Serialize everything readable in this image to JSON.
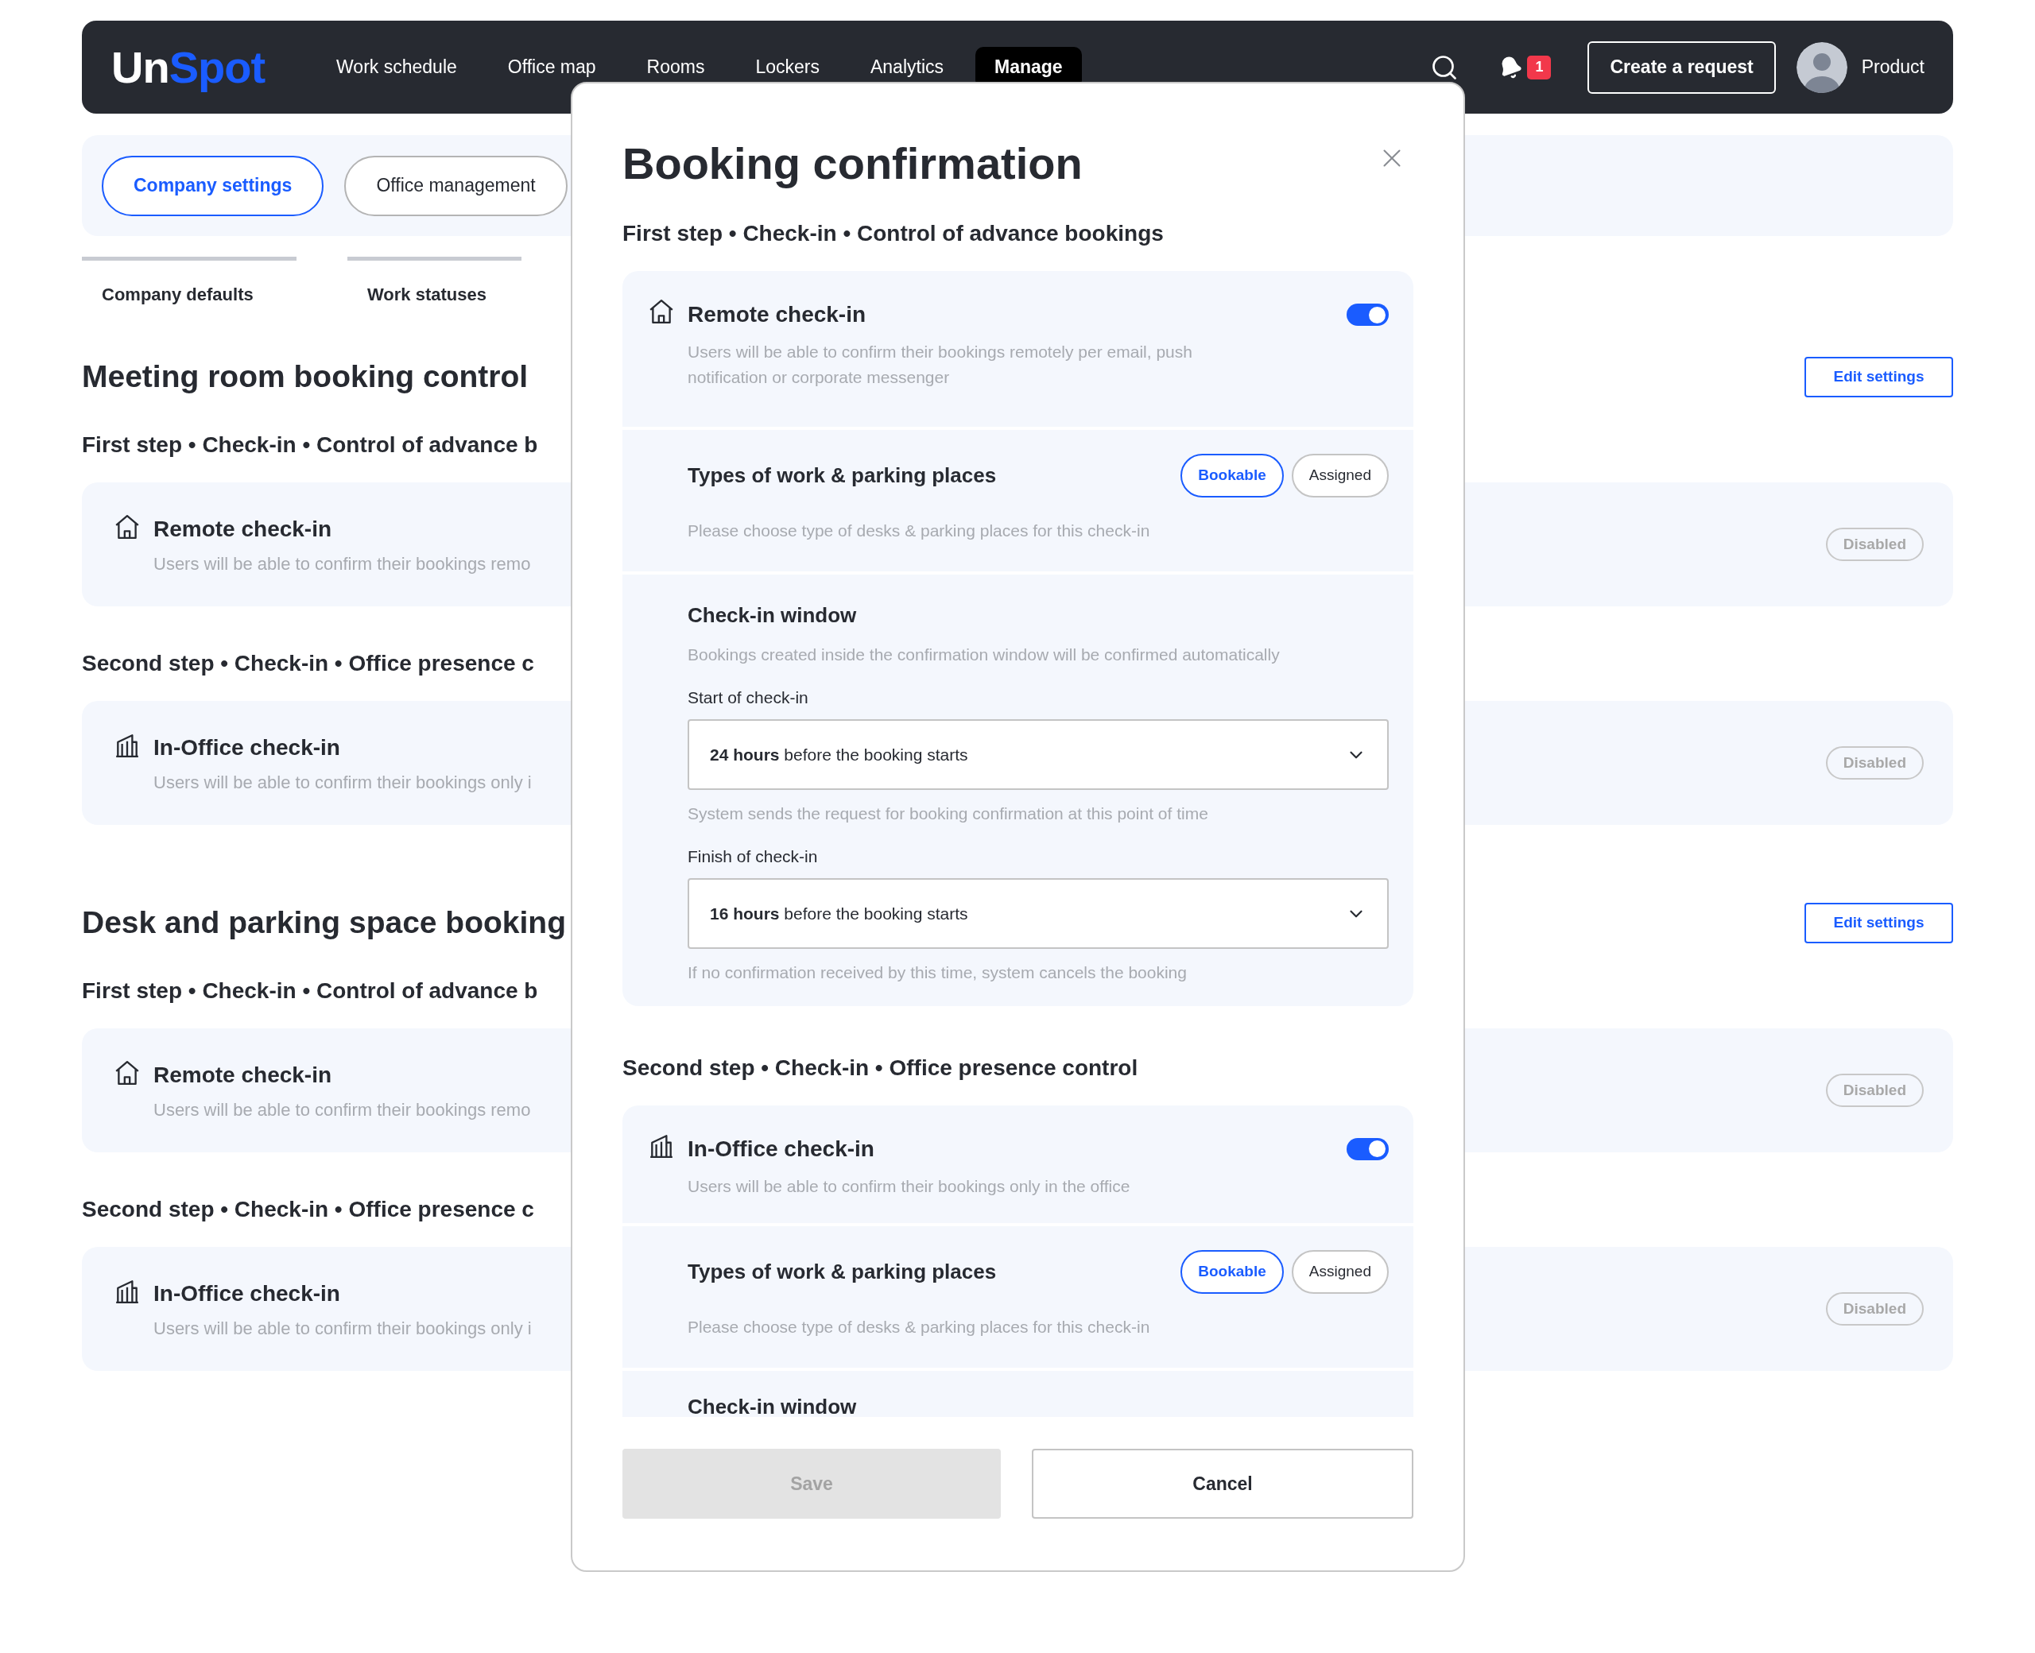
{
  "header": {
    "logo": {
      "first": "Un",
      "second": "Spot"
    },
    "nav": [
      {
        "label": "Work schedule",
        "selected": false
      },
      {
        "label": "Office map",
        "selected": false
      },
      {
        "label": "Rooms",
        "selected": false
      },
      {
        "label": "Lockers",
        "selected": false
      },
      {
        "label": "Analytics",
        "selected": false
      },
      {
        "label": "Manage",
        "selected": true
      }
    ],
    "notifications_badge": "1",
    "create_button": "Create a request",
    "user_name": "Product"
  },
  "section_tabs": [
    {
      "label": "Company settings",
      "selected": true
    },
    {
      "label": "Office management",
      "selected": false
    }
  ],
  "sub_tabs": [
    {
      "label": "Company defaults"
    },
    {
      "label": "Work statuses"
    }
  ],
  "sections": [
    {
      "title": "Meeting room booking control",
      "edit_button": "Edit settings",
      "steps": [
        {
          "heading": "First step • Check-in • Control of advance b",
          "card": {
            "kind": "remote",
            "title": "Remote check-in",
            "description": "Users will be able to confirm their bookings remo",
            "status": "Disabled"
          }
        },
        {
          "heading": "Second step • Check-in • Office presence c",
          "card": {
            "kind": "office",
            "title": "In-Office check-in",
            "description": "Users will be able to confirm their bookings only i",
            "status": "Disabled"
          }
        }
      ]
    },
    {
      "title": "Desk and parking space booking",
      "edit_button": "Edit settings",
      "steps": [
        {
          "heading": "First step • Check-in • Control of advance b",
          "card": {
            "kind": "remote",
            "title": "Remote check-in",
            "description": "Users will be able to confirm their bookings remo",
            "status": "Disabled"
          }
        },
        {
          "heading": "Second step • Check-in • Office presence c",
          "card": {
            "kind": "office",
            "title": "In-Office check-in",
            "description": "Users will be able to confirm their bookings only i",
            "status": "Disabled"
          }
        }
      ]
    }
  ],
  "dialog": {
    "title": "Booking confirmation",
    "steps": [
      {
        "heading": "First step • Check-in • Control of advance bookings",
        "setting": {
          "kind": "remote",
          "title": "Remote check-in",
          "description": "Users will be able to confirm their bookings remotely per email, push notification or corporate messenger",
          "on": true
        },
        "types": {
          "title": "Types of work & parking places",
          "description": "Please choose type of desks & parking places for this check-in",
          "options": [
            {
              "label": "Bookable",
              "selected": true
            },
            {
              "label": "Assigned",
              "selected": false
            }
          ]
        },
        "window": {
          "title": "Check-in window",
          "description": "Bookings created inside the confirmation window will be confirmed automatically",
          "fields": [
            {
              "label": "Start of check-in",
              "value": "**24 hours** before the booking starts",
              "help": "System sends the request for booking confirmation at this point of time"
            },
            {
              "label": "Finish of check-in",
              "value": "**16 hours** before the booking starts",
              "help": "If no confirmation received by this time, system cancels the booking"
            }
          ]
        }
      },
      {
        "heading": "Second step • Check-in • Office presence control",
        "setting": {
          "kind": "office",
          "title": "In-Office check-in",
          "description": "Users will be able to confirm their bookings only in the office",
          "on": true
        },
        "types": {
          "title": "Types of work & parking places",
          "description": "Please choose type of desks & parking places for this check-in",
          "options": [
            {
              "label": "Bookable",
              "selected": true
            },
            {
              "label": "Assigned",
              "selected": false
            }
          ]
        },
        "window": {
          "title": "Check-in window"
        }
      }
    ],
    "buttons": {
      "save": {
        "label": "Save",
        "disabled": true
      },
      "cancel": "Cancel"
    }
  }
}
